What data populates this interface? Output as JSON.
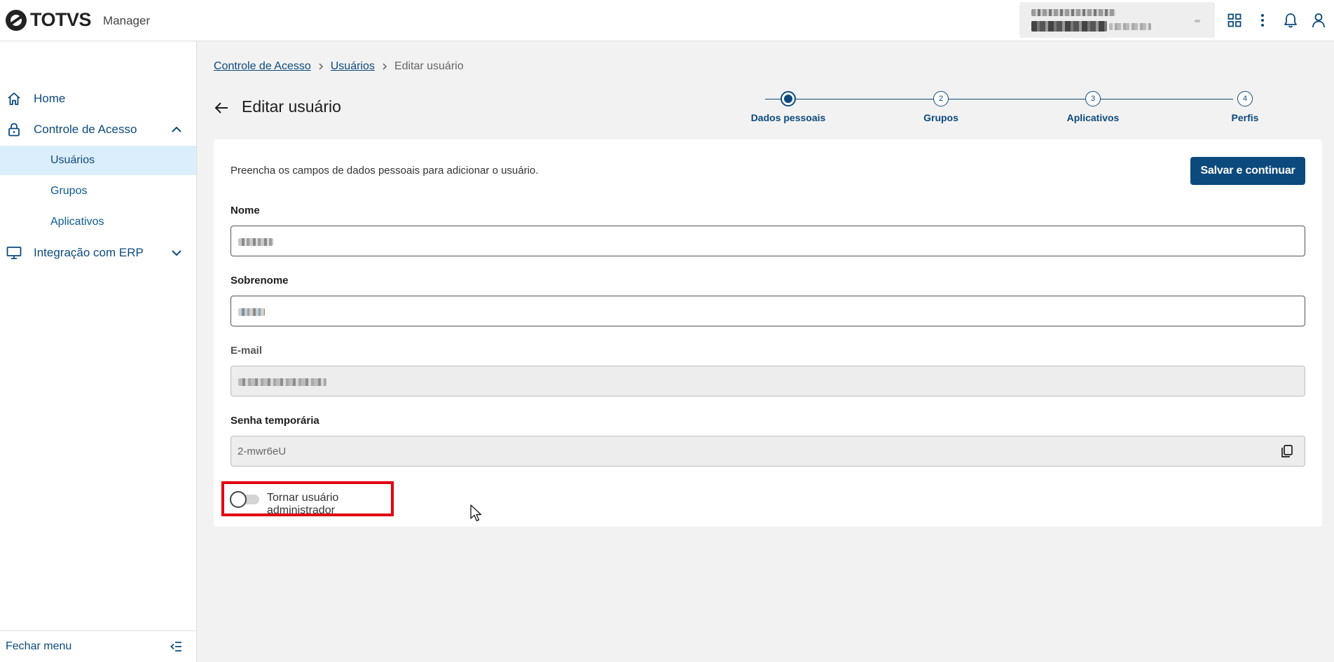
{
  "app": {
    "brand": "TOTVS",
    "app_name": "Manager"
  },
  "sidebar": {
    "items": [
      {
        "label": "Home",
        "icon": "home-icon"
      },
      {
        "label": "Controle de Acesso",
        "icon": "lock-icon",
        "expanded": true,
        "children": [
          {
            "label": "Usuários",
            "active": true
          },
          {
            "label": "Grupos"
          },
          {
            "label": "Aplicativos"
          }
        ]
      },
      {
        "label": "Integração com ERP",
        "icon": "monitor-icon",
        "expanded": false
      }
    ],
    "footer_label": "Fechar menu"
  },
  "breadcrumb": {
    "items": [
      "Controle de Acesso",
      "Usuários"
    ],
    "current": "Editar usuário"
  },
  "page": {
    "title": "Editar usuário"
  },
  "stepper": {
    "steps": [
      {
        "label": "Dados pessoais",
        "number": "1",
        "state": "current"
      },
      {
        "label": "Grupos",
        "number": "2",
        "state": "pending"
      },
      {
        "label": "Aplicativos",
        "number": "3",
        "state": "pending"
      },
      {
        "label": "Perfis",
        "number": "4",
        "state": "pending"
      }
    ]
  },
  "form": {
    "description": "Preencha os campos de dados pessoais para adicionar o usuário.",
    "save_label": "Salvar e continuar",
    "nome_label": "Nome",
    "sobrenome_label": "Sobrenome",
    "email_label": "E-mail",
    "senha_label": "Senha temporária",
    "senha_value": "2-mwr6eU",
    "admin_toggle_label": "Tornar usuário administrador",
    "admin_toggle_on": false
  },
  "colors": {
    "primary": "#0c4a7d",
    "highlight": "#e00010",
    "active_nav_bg": "#dbeefb"
  }
}
